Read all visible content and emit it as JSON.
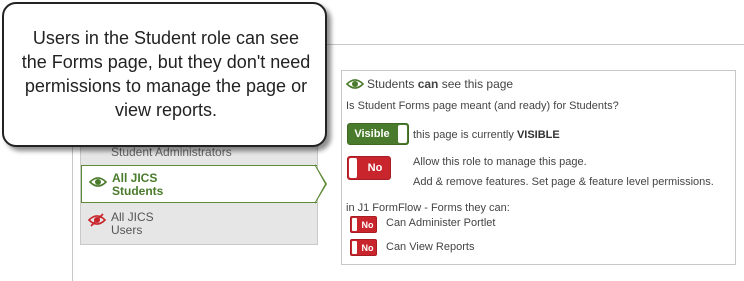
{
  "callout": {
    "text": "Users in the Student role can see the Forms page, but they don't need permissions to manage the page or view reports."
  },
  "roles": [
    {
      "label_line1": "Student Administrators",
      "label_line2": "",
      "icon": "eye-icon"
    },
    {
      "label_line1": "All JICS",
      "label_line2": "Students",
      "icon": "eye-icon",
      "selected": true
    },
    {
      "label_line1": "All JICS",
      "label_line2": "Users",
      "icon": "eye-slash-icon"
    }
  ],
  "panel": {
    "header_prefix": "Students ",
    "header_bold": "can",
    "header_suffix": " see this page",
    "question": "Is Student Forms page meant (and ready) for Students?",
    "visible_toggle_label": "Visible",
    "visible_text_prefix": "this page is currently ",
    "visible_text_bold": "VISIBLE",
    "manage_toggle_label": "No",
    "manage_line1": "Allow this role to manage this page.",
    "manage_line2": "Add & remove features. Set page & feature level permissions.",
    "formflow_label": "in J1 FormFlow - Forms they can:",
    "permissions": [
      {
        "toggle_label": "No",
        "label": "Can Administer Portlet"
      },
      {
        "toggle_label": "No",
        "label": "Can View Reports"
      }
    ]
  },
  "colors": {
    "accent_green": "#4a7b2c",
    "deny_red": "#c9252c",
    "eye_slash_red": "#c9252c"
  }
}
